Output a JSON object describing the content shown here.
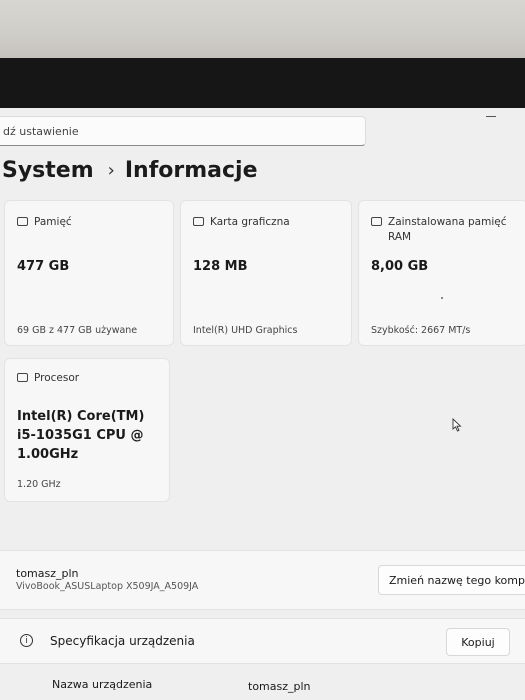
{
  "search": {
    "value": "dź ustawienie"
  },
  "breadcrumb": {
    "parent": "System",
    "separator": "›",
    "current": "Informacje"
  },
  "cards": {
    "storage": {
      "icon": "storage-icon",
      "label": "Pamięć",
      "value": "477 GB",
      "detail": "69 GB z 477 GB używane"
    },
    "gpu": {
      "icon": "graphics-card-icon",
      "label": "Karta graficzna",
      "value": "128 MB",
      "detail": "Intel(R) UHD Graphics"
    },
    "ram": {
      "icon": "ram-icon",
      "label": "Zainstalowana pamięć RAM",
      "value": "8,00 GB",
      "detail": "Szybkość: 2667 MT/s"
    },
    "cpu": {
      "icon": "processor-icon",
      "label": "Procesor",
      "value": "Intel(R) Core(TM) i5-1035G1 CPU @ 1.00GHz",
      "detail": "1.20 GHz"
    }
  },
  "device": {
    "user": "tomasz_pln",
    "model": "VivoBook_ASUSLaptop X509JA_A509JA",
    "rename_label": "Zmień nazwę tego kompu"
  },
  "spec": {
    "title": "Specyfikacja urządzenia",
    "copy_label": "Kopiuj"
  },
  "device_name": {
    "label": "Nazwa urządzenia",
    "value": "tomasz_pln"
  }
}
